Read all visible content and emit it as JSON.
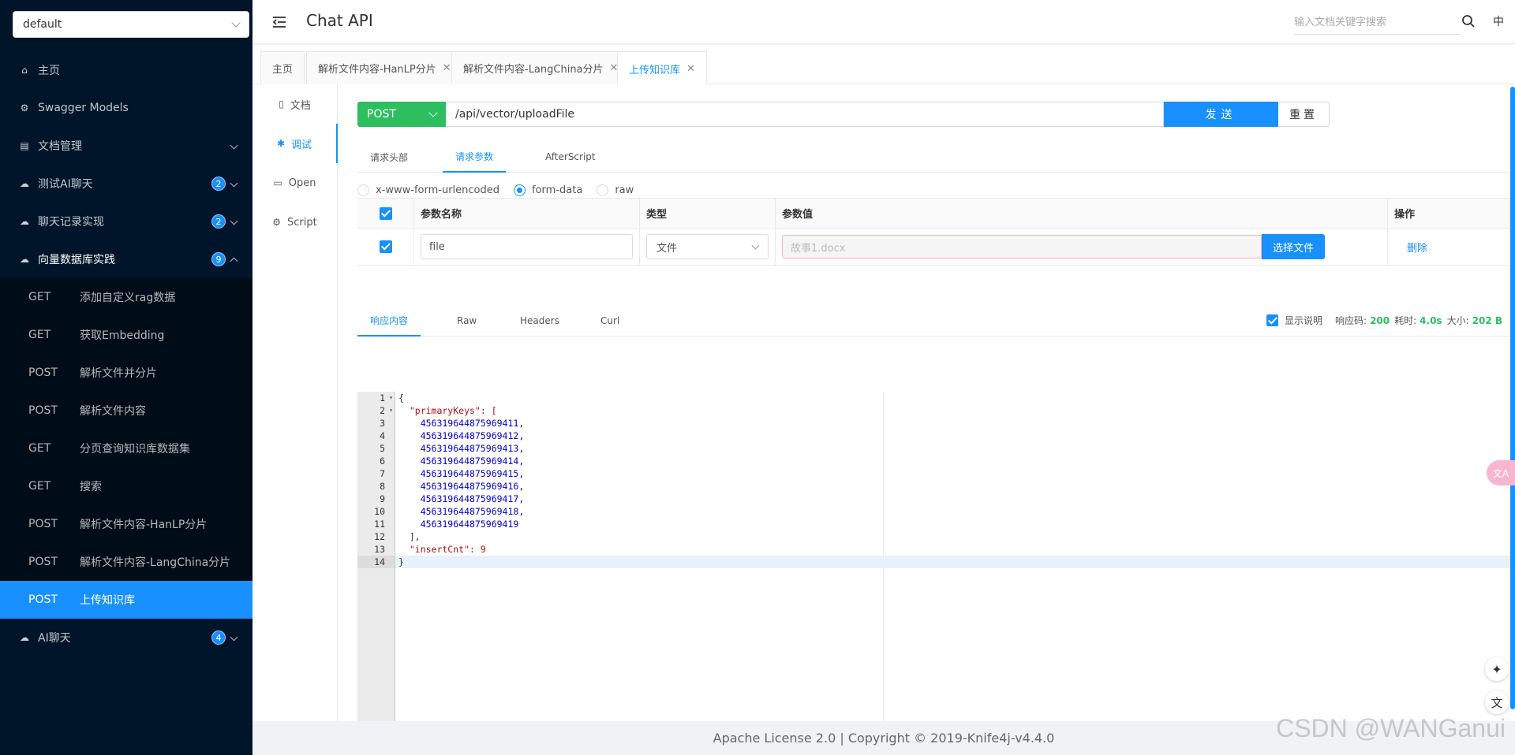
{
  "sidebar": {
    "group_value": "default",
    "menu": [
      {
        "label": "主页",
        "icon": "home-icon"
      },
      {
        "label": "Swagger Models",
        "icon": "models-icon"
      },
      {
        "label": "文档管理",
        "icon": "doc-manage-icon"
      },
      {
        "label": "测试AI聊天",
        "icon": "cloud-icon",
        "badge": "2"
      },
      {
        "label": "聊天记录实现",
        "icon": "cloud-icon",
        "badge": "2"
      },
      {
        "label": "向量数据库实践",
        "icon": "cloud-icon",
        "badge": "9"
      }
    ],
    "submenu": [
      {
        "method": "GET",
        "label": "添加自定义rag数据"
      },
      {
        "method": "GET",
        "label": "获取Embedding"
      },
      {
        "method": "POST",
        "label": "解析文件并分片"
      },
      {
        "method": "POST",
        "label": "解析文件内容"
      },
      {
        "method": "GET",
        "label": "分页查询知识库数据集"
      },
      {
        "method": "GET",
        "label": "搜索"
      },
      {
        "method": "POST",
        "label": "解析文件内容-HanLP分片"
      },
      {
        "method": "POST",
        "label": "解析文件内容-LangChina分片"
      },
      {
        "method": "POST",
        "label": "上传知识库"
      }
    ],
    "last_menu": {
      "label": "AI聊天",
      "badge": "4"
    }
  },
  "header": {
    "title": "Chat API",
    "search_placeholder": "输入文档关键字搜索",
    "lang": "中"
  },
  "tabs": [
    {
      "label": "主页"
    },
    {
      "label": "解析文件内容-HanLP分片"
    },
    {
      "label": "解析文件内容-LangChina分片"
    },
    {
      "label": "上传知识库"
    }
  ],
  "vtabs": [
    {
      "label": "文档",
      "icon": "document-icon"
    },
    {
      "label": "调试",
      "icon": "debug-icon"
    },
    {
      "label": "Open",
      "icon": "open-icon"
    },
    {
      "label": "Script",
      "icon": "script-icon"
    }
  ],
  "request": {
    "method": "POST",
    "url": "/api/vector/uploadFile",
    "send_label": "发送",
    "reset_label": "重置",
    "tabs": [
      "请求头部",
      "请求参数",
      "AfterScript"
    ],
    "body_types": [
      "x-www-form-urlencoded",
      "form-data",
      "raw"
    ],
    "columns": [
      "参数名称",
      "类型",
      "参数值",
      "操作"
    ],
    "param": {
      "name": "file",
      "type": "文件",
      "value_placeholder": "故事1.docx",
      "choose_label": "选择文件",
      "delete_label": "删除"
    }
  },
  "response": {
    "tabs": [
      "响应内容",
      "Raw",
      "Headers",
      "Curl"
    ],
    "show_desc_label": "显示说明",
    "status_label": "响应码:",
    "status": "200",
    "time_label": "耗时:",
    "time": "4.0s",
    "size_label": "大小:",
    "size": "202 B",
    "lines": [
      "{",
      "  \"primaryKeys\": [",
      "    456319644875969411,",
      "    456319644875969412,",
      "    456319644875969413,",
      "    456319644875969414,",
      "    456319644875969415,",
      "    456319644875969416,",
      "    456319644875969417,",
      "    456319644875969418,",
      "    456319644875969419",
      "  ],",
      "  \"insertCnt\": 9",
      "}"
    ]
  },
  "footer": {
    "text": "Apache License 2.0 | Copyright © 2019-Knife4j-v4.4.0",
    "watermark": "CSDN @WANGanui"
  },
  "floating": {
    "translate_label": "文A"
  }
}
